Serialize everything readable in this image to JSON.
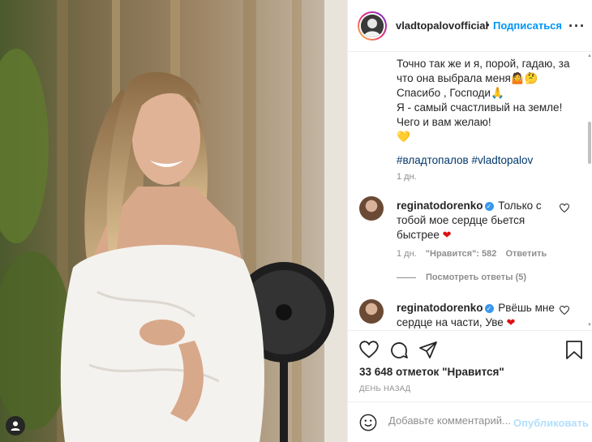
{
  "post": {
    "username": "vladtopalovofficial",
    "separator": "•",
    "follow_label": "Подписаться",
    "more_label": "···"
  },
  "caption": {
    "lines": [
      "Точно так же и я, порой, гадаю, за",
      "что она выбрала меня🤷🤔",
      "Спасибо , Господи🙏",
      "Я - самый счастливый на земле!",
      "Чего и вам желаю!",
      "💛"
    ],
    "hashtags": "#владтопалов #vladtopalov",
    "age": "1 дн."
  },
  "comments": [
    {
      "username": "reginatodorenko",
      "verified_mark": "✓",
      "text_line1": "Только с",
      "text_line2": "тобой мое сердце бьется",
      "text_line3": "быстрее",
      "heart_emoji": "❤",
      "age": "1 дн.",
      "likes": "\"Нравится\": 582",
      "reply_label": "Ответить",
      "view_replies": "Посмотреть ответы (5)"
    },
    {
      "username": "reginatodorenko",
      "verified_mark": "✓",
      "text_line1": "Рвёшь мне",
      "text_line2": "сердце на части, Уве",
      "heart_emoji": "❤"
    }
  ],
  "actions": {
    "like_icon": "heart-icon",
    "comment_icon": "comment-icon",
    "share_icon": "share-icon",
    "save_icon": "bookmark-icon"
  },
  "stats": {
    "likes_text": "33 648 отметок \"Нравится\"",
    "timestamp": "ДЕНЬ НАЗАД"
  },
  "comment_box": {
    "placeholder": "Добавьте комментарий...",
    "publish_label": "Опубликовать"
  },
  "colors": {
    "accent": "#0095f6",
    "publish_disabled": "#b2dffc",
    "muted": "#8e8e8e"
  }
}
